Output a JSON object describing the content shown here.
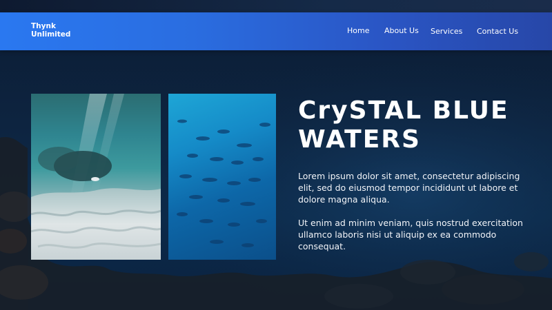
{
  "brand": {
    "line1": "Thynk",
    "line2": "Unlimited"
  },
  "nav": {
    "items": [
      {
        "label": "Home"
      },
      {
        "label": "About Us"
      },
      {
        "label": "Services"
      },
      {
        "label": "Contact Us"
      }
    ]
  },
  "hero": {
    "title_line1": "CrySTAL BLUE",
    "title_line2": "WATERS",
    "paragraph1": "Lorem ipsum dolor sit amet, consectetur adipiscing elit, sed do eiusmod tempor incididunt ut labore et dolore magna aliqua.",
    "paragraph2": "Ut enim ad minim veniam, quis nostrud exercitation ullamco laboris nisi ut aliquip ex ea commodo consequat."
  },
  "colors": {
    "navbar_left": "#2a78f0",
    "navbar_right": "#2747a8",
    "background": "#0d2440",
    "text": "#ffffff"
  },
  "images": {
    "left_photo": "underwater-sandy-seabed-photo",
    "right_photo": "fish-school-blue-water-photo"
  }
}
